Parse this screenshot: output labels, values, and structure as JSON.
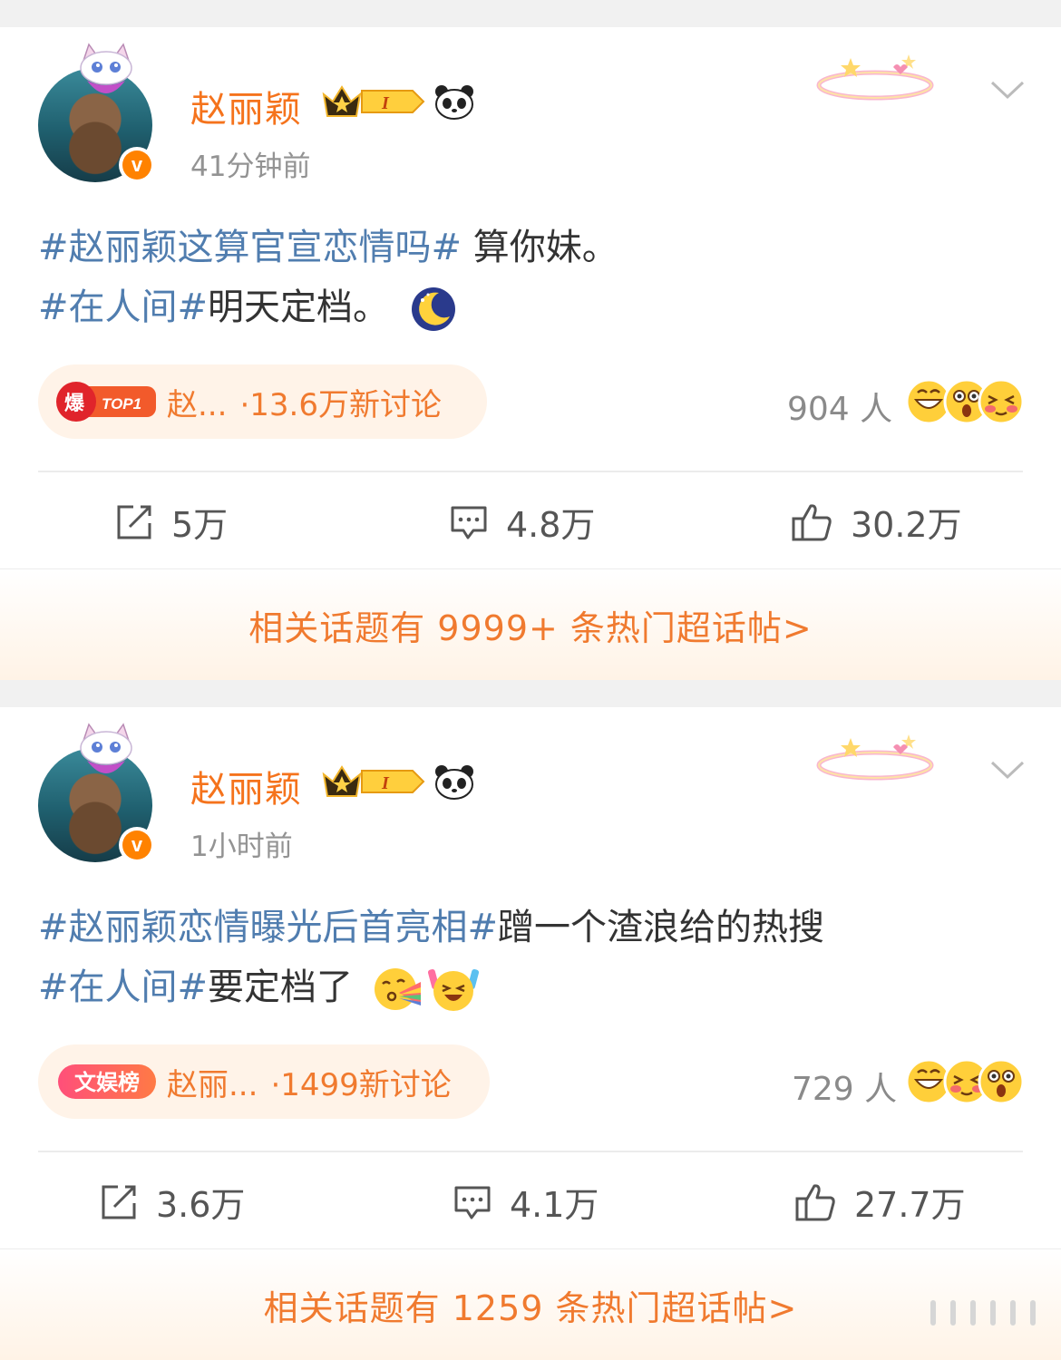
{
  "posts": [
    {
      "username": "赵丽颖",
      "time": "41分钟前",
      "line1_tag": "#赵丽颖这算官宣恋情吗#",
      "line1_text": " 算你妹。",
      "line2_tag": "#在人间#",
      "line2_text": "明天定档。",
      "line2_emojis": [
        "moon-icon"
      ],
      "topic_badge_main": "爆",
      "topic_badge_sub": "TOP1",
      "topic_title": "赵...",
      "topic_count": "·13.6万新讨论",
      "people": "904 人",
      "reactions": [
        "grin-face-icon",
        "shocked-face-icon",
        "blush-face-icon"
      ],
      "repost": "5万",
      "comment": "4.8万",
      "like": "30.2万",
      "footer": "相关话题有 9999+ 条热门超话帖>"
    },
    {
      "username": "赵丽颖",
      "time": "1小时前",
      "line1_tag": "#赵丽颖恋情曝光后首亮相#",
      "line1_text": "蹭一个渣浪给的热搜",
      "line2_tag": "#在人间#",
      "line2_text": "要定档了",
      "line2_emojis": [
        "rainbow-kiss-icon",
        "cheering-face-icon"
      ],
      "topic_badge_main": "文娱榜",
      "topic_title": "赵丽...",
      "topic_count": "·1499新讨论",
      "people": "729 人",
      "reactions": [
        "grin-face-icon",
        "blush-face-icon",
        "shocked-face-icon"
      ],
      "repost": "3.6万",
      "comment": "4.1万",
      "like": "27.7万",
      "footer": "相关话题有 1259 条热门超话帖>"
    }
  ],
  "colors": {
    "username": "#f5731c",
    "hashtag": "#507daf",
    "accent": "#f07a2f",
    "verified": "#ff8200"
  }
}
